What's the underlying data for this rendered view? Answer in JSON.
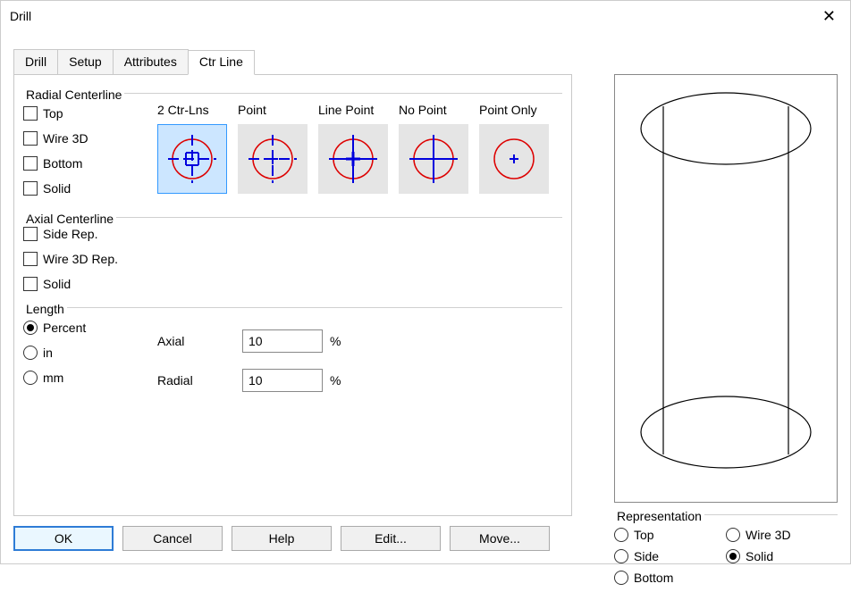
{
  "window": {
    "title": "Drill"
  },
  "tabs": {
    "items": [
      {
        "label": "Drill"
      },
      {
        "label": "Setup"
      },
      {
        "label": "Attributes"
      },
      {
        "label": "Ctr Line"
      }
    ],
    "active_index": 3
  },
  "groups": {
    "radial": {
      "title": "Radial Centerline",
      "checks": {
        "top": "Top",
        "wire3d": "Wire 3D",
        "bottom": "Bottom",
        "solid": "Solid"
      },
      "icons": {
        "ctr2": "2 Ctr-Lns",
        "point": "Point",
        "linepoint": "Line Point",
        "nopoint": "No Point",
        "pointonly": "Point Only"
      }
    },
    "axial": {
      "title": "Axial Centerline",
      "checks": {
        "side": "Side Rep.",
        "wire3d": "Wire 3D Rep.",
        "solid": "Solid"
      }
    },
    "length": {
      "title": "Length",
      "radios": {
        "percent": "Percent",
        "inch": "in",
        "mm": "mm"
      },
      "fields": {
        "axial": {
          "label": "Axial",
          "value": "10",
          "unit": "%"
        },
        "radial": {
          "label": "Radial",
          "value": "10",
          "unit": "%"
        }
      }
    }
  },
  "buttons": {
    "ok": "OK",
    "cancel": "Cancel",
    "help": "Help",
    "edit": "Edit...",
    "move": "Move..."
  },
  "representation": {
    "title": "Representation",
    "options": {
      "top": "Top",
      "side": "Side",
      "bottom": "Bottom",
      "wire3d": "Wire 3D",
      "solid": "Solid"
    },
    "selected": "solid"
  }
}
